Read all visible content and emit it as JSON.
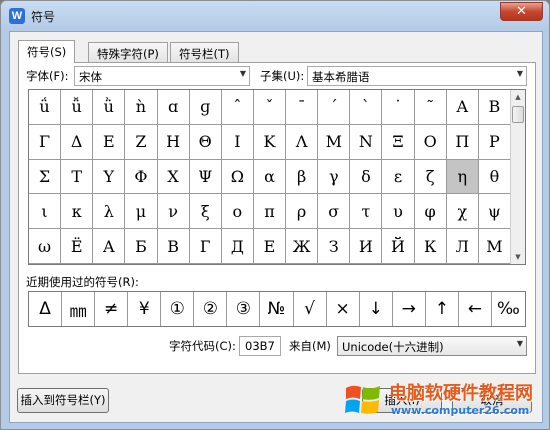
{
  "window": {
    "title": "符号",
    "app_icon": "wps-writer-icon",
    "close_label": "✕"
  },
  "tabs": [
    {
      "label": "符号(S)",
      "active": true
    },
    {
      "label": "特殊字符(P)",
      "active": false
    },
    {
      "label": "符号栏(T)",
      "active": false
    }
  ],
  "font": {
    "label": "字体(F):",
    "value": "宋体"
  },
  "subset": {
    "label": "子集(U):",
    "value": "基本希腊语"
  },
  "symbols": [
    [
      "ǘ",
      "ǚ",
      "ǜ",
      "ǹ",
      "ɑ",
      "ɡ",
      "ˆ",
      "ˇ",
      "ˉ",
      "ˊ",
      "ˋ",
      "˙",
      "˜",
      "Α",
      "Β"
    ],
    [
      "Γ",
      "Δ",
      "Ε",
      "Ζ",
      "Η",
      "Θ",
      "Ι",
      "Κ",
      "Λ",
      "Μ",
      "Ν",
      "Ξ",
      "Ο",
      "Π",
      "Ρ"
    ],
    [
      "Σ",
      "Τ",
      "Υ",
      "Φ",
      "Χ",
      "Ψ",
      "Ω",
      "α",
      "β",
      "γ",
      "δ",
      "ε",
      "ζ",
      "η",
      "θ"
    ],
    [
      "ι",
      "κ",
      "λ",
      "μ",
      "ν",
      "ξ",
      "ο",
      "π",
      "ρ",
      "σ",
      "τ",
      "υ",
      "φ",
      "χ",
      "ψ"
    ],
    [
      "ω",
      "Ё",
      "А",
      "Б",
      "В",
      "Г",
      "Д",
      "Е",
      "Ж",
      "З",
      "И",
      "Й",
      "К",
      "Л",
      "М"
    ]
  ],
  "selected_symbol": "η",
  "recent": {
    "label": "近期使用过的符号(R):",
    "symbols": [
      "Δ",
      "㎜",
      "≠",
      "¥",
      "①",
      "②",
      "③",
      "№",
      "√",
      "×",
      "↓",
      "→",
      "↑",
      "←",
      "‰"
    ]
  },
  "char_code": {
    "label": "字符代码(C):",
    "value": "03B7"
  },
  "from": {
    "label": "来自(M)",
    "value": "Unicode(十六进制)"
  },
  "buttons": {
    "insert_to_bar": "插入到符号栏(Y)",
    "insert": "插入(I)",
    "cancel": "取消"
  },
  "watermark": {
    "text": "电脑软硬件教程网",
    "url": "www.computer26.com"
  }
}
